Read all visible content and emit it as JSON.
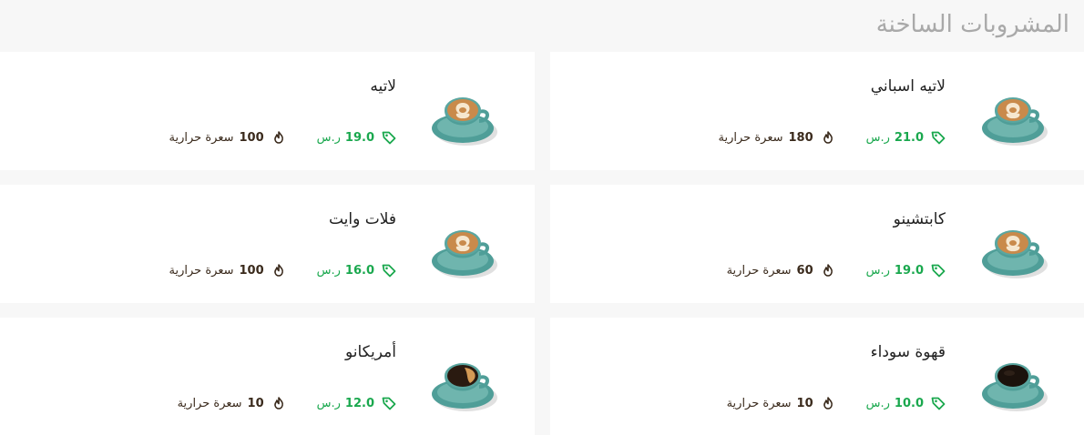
{
  "section": {
    "title": "المشروبات الساخنة"
  },
  "colors": {
    "price": "#1aa84e",
    "calories": "#3a2a1c",
    "title_gray": "#a9a9a9",
    "cup": "#4f9e98"
  },
  "items": [
    {
      "name": "لاتيه اسباني",
      "price": "21.0",
      "currency": "ر.س",
      "calories": "180",
      "calories_label": "سعرة حرارية",
      "drink": "latte"
    },
    {
      "name": "لاتيه",
      "price": "19.0",
      "currency": "ر.س",
      "calories": "100",
      "calories_label": "سعرة حرارية",
      "drink": "latte"
    },
    {
      "name": "كابتشينو",
      "price": "19.0",
      "currency": "ر.س",
      "calories": "60",
      "calories_label": "سعرة حرارية",
      "drink": "latte"
    },
    {
      "name": "فلات وايت",
      "price": "16.0",
      "currency": "ر.س",
      "calories": "100",
      "calories_label": "سعرة حرارية",
      "drink": "latte"
    },
    {
      "name": "قهوة سوداء",
      "price": "10.0",
      "currency": "ر.س",
      "calories": "10",
      "calories_label": "سعرة حرارية",
      "drink": "black"
    },
    {
      "name": "أمريكانو",
      "price": "12.0",
      "currency": "ر.س",
      "calories": "10",
      "calories_label": "سعرة حرارية",
      "drink": "americano"
    }
  ]
}
